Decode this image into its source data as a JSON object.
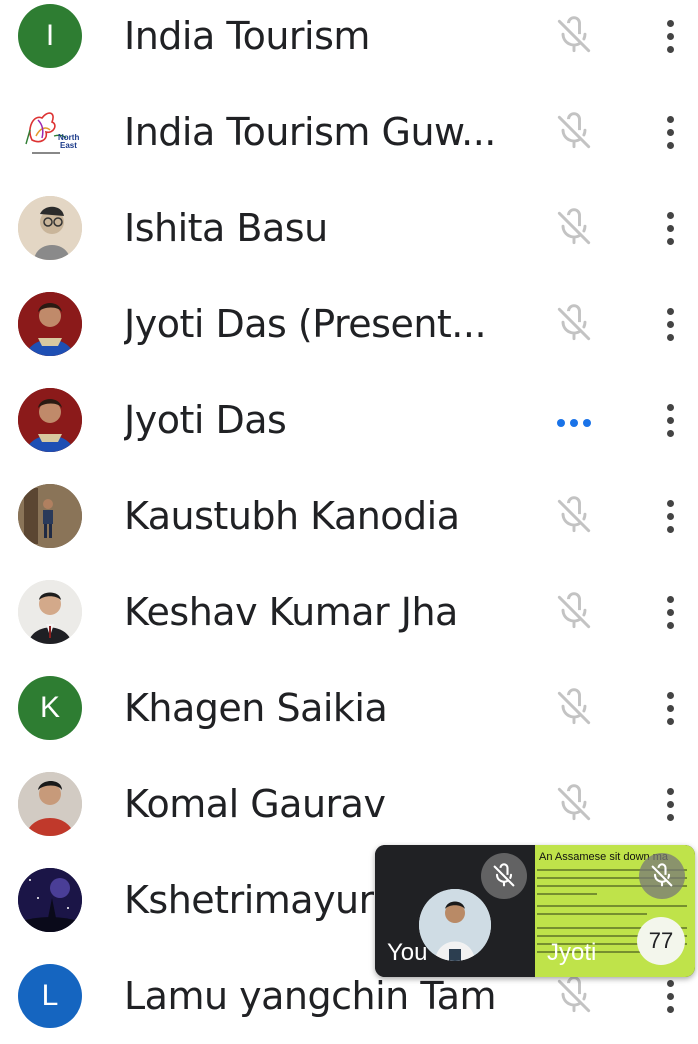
{
  "participants": [
    {
      "name": "India Tourism",
      "avatar_letter": "I",
      "avatar_type": "letter",
      "status": "muted"
    },
    {
      "name": "India Tourism Guw...",
      "avatar_type": "logo-north-east",
      "status": "muted"
    },
    {
      "name": "Ishita Basu",
      "avatar_type": "photo",
      "status": "muted"
    },
    {
      "name": "Jyoti Das (Present...",
      "avatar_type": "photo",
      "status": "muted"
    },
    {
      "name": "Jyoti Das",
      "avatar_type": "photo",
      "status": "speaking"
    },
    {
      "name": "Kaustubh Kanodia",
      "avatar_type": "photo",
      "status": "muted"
    },
    {
      "name": "Keshav Kumar Jha",
      "avatar_type": "photo",
      "status": "muted"
    },
    {
      "name": "Khagen Saikia",
      "avatar_letter": "K",
      "avatar_type": "letter",
      "status": "muted"
    },
    {
      "name": "Komal Gaurav",
      "avatar_type": "photo",
      "status": "muted"
    },
    {
      "name": "Kshetrimayur",
      "avatar_type": "photo",
      "status": "muted"
    },
    {
      "name": "Lamu yangchin Tam",
      "avatar_letter": "L",
      "avatar_type": "letter",
      "status": "muted"
    }
  ],
  "logo_text": {
    "line1": "North",
    "line2": "East"
  },
  "icons": {
    "muted": "mic-off-icon",
    "speaking": "audio-dots-icon",
    "more": "more-vert-icon"
  },
  "tiles": {
    "you_label": "You",
    "presenter_label": "Jyoti",
    "slide_title": "An Assamese sit down ma",
    "participant_count": "77"
  },
  "colors": {
    "avatar_green": "#2e7d32",
    "avatar_blue": "#1565c0",
    "speaking_blue": "#1a73e8",
    "slide_bg": "#bfe34a"
  }
}
